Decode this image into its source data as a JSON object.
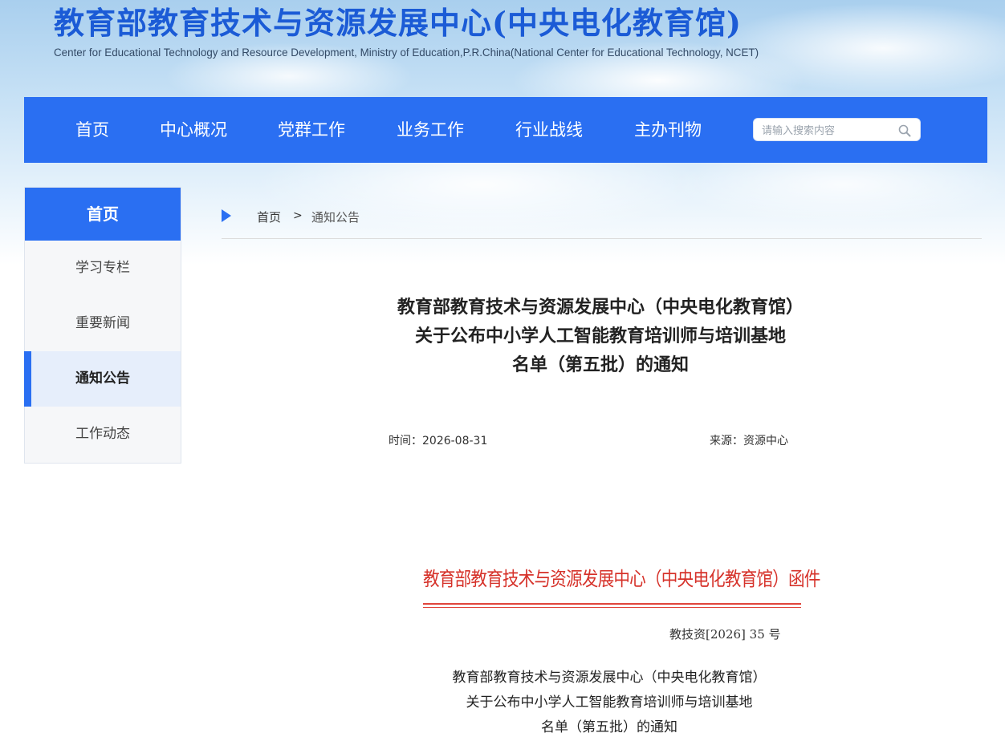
{
  "header": {
    "title": "教育部教育技术与资源发展中心(中央电化教育馆)",
    "subtitle": "Center for Educational Technology and Resource Development, Ministry of Education,P.R.China(National Center for Educational Technology, NCET)"
  },
  "nav": {
    "items": [
      "首页",
      "中心概况",
      "党群工作",
      "业务工作",
      "行业战线",
      "主办刊物"
    ],
    "search_placeholder": "请输入搜索内容",
    "search_icon": "search-icon"
  },
  "sidebar": {
    "heading": "首页",
    "items": [
      "学习专栏",
      "重要新闻",
      "通知公告",
      "工作动态"
    ],
    "active": "通知公告"
  },
  "breadcrumb": {
    "home": "首页",
    "separator": ">",
    "current": "通知公告"
  },
  "article": {
    "title_lines": [
      "教育部教育技术与资源发展中心（中央电化教育馆）",
      "关于公布中小学人工智能教育培训师与培训基地",
      "名单（第五批）的通知"
    ],
    "time": "时间：2026-08-31",
    "source": "来源：资源中心"
  },
  "document": {
    "letterhead": "教育部教育技术与资源发展中心（中央电化教育馆）函件",
    "doc_number": "教技资[2026] 35 号",
    "title_lines": [
      "教育部教育技术与资源发展中心（中央电化教育馆）",
      "关于公布中小学人工智能教育培训师与培训基地",
      "名单（第五批）的通知"
    ]
  },
  "colors": {
    "brand_blue": "#2a6ff2",
    "title_blue": "#1b5bd6",
    "letterhead_red": "#d6322a"
  }
}
